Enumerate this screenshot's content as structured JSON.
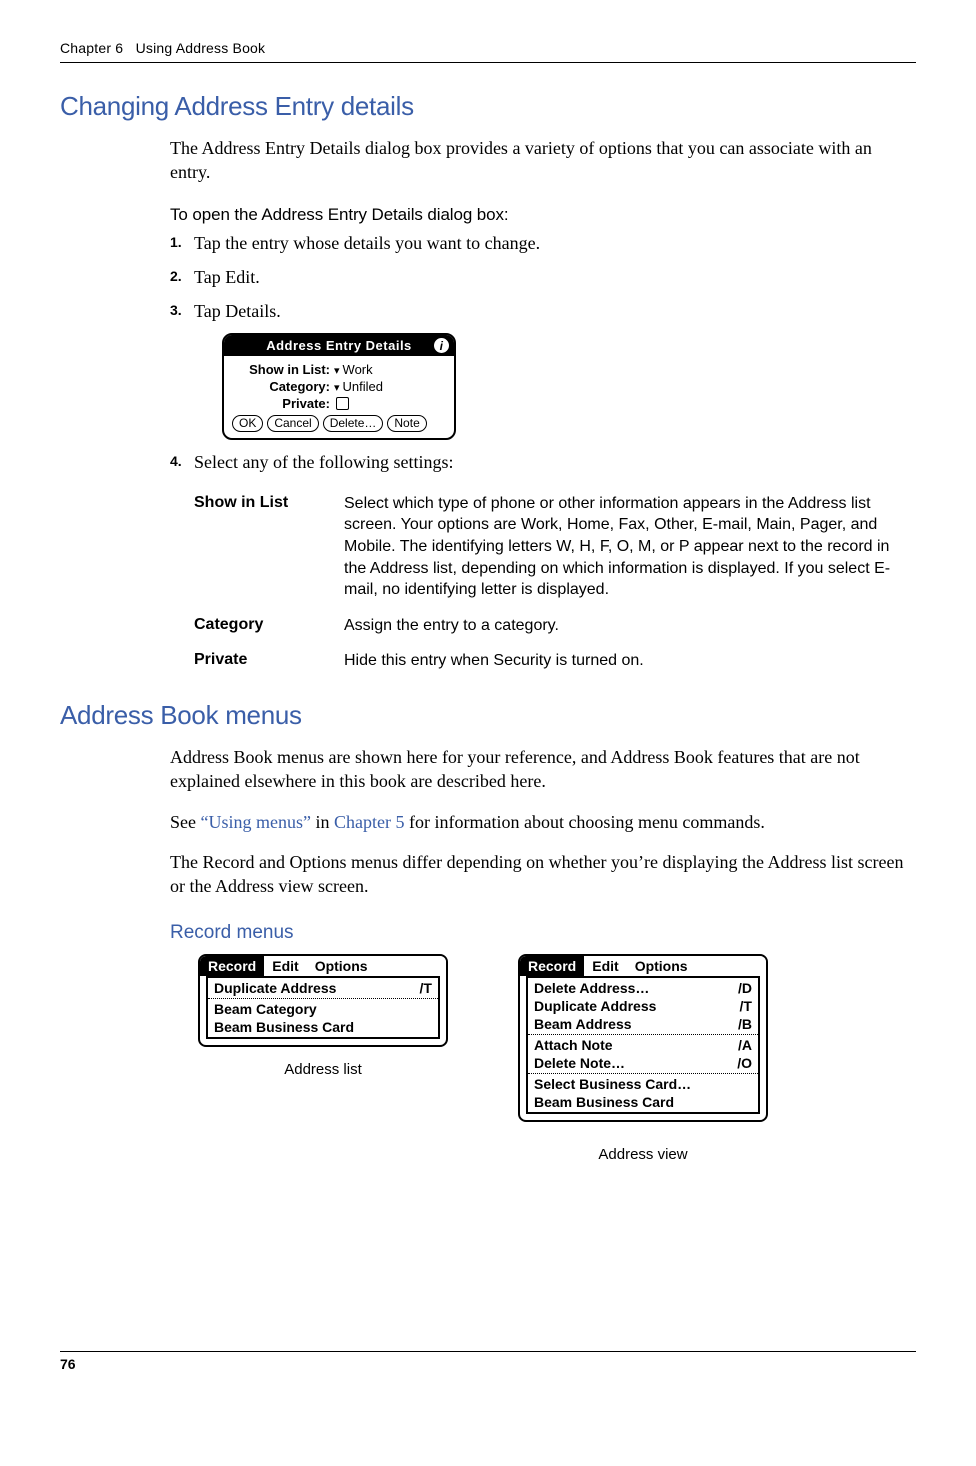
{
  "chapter_label": "Chapter 6",
  "chapter_title": "Using Address Book",
  "section1_title": "Changing Address Entry details",
  "section1_intro": "The Address Entry Details dialog box provides a variety of options that you can associate with an entry.",
  "howto_title": "To open the Address Entry Details dialog box:",
  "steps": {
    "1": "Tap the entry whose details you want to change.",
    "2": "Tap Edit.",
    "3": "Tap Details.",
    "4": "Select any of the following settings:"
  },
  "dialog": {
    "title": "Address Entry Details",
    "show_in_list_label": "Show in List:",
    "show_in_list_value": "Work",
    "category_label": "Category:",
    "category_value": "Unfiled",
    "private_label": "Private:",
    "buttons": {
      "ok": "OK",
      "cancel": "Cancel",
      "delete": "Delete…",
      "note": "Note"
    }
  },
  "settings": {
    "show_in_list_label": "Show in List",
    "show_in_list_desc": "Select which type of phone or other information appears in the Address list screen. Your options are Work, Home, Fax, Other, E-mail, Main, Pager, and Mobile. The identifying letters W, H, F, O, M, or P appear next to the record in the Address list, depending on which information is displayed. If you select E-mail, no identifying letter is displayed.",
    "category_label": "Category",
    "category_desc": "Assign the entry to a category.",
    "private_label": "Private",
    "private_desc": "Hide this entry when Security is turned on."
  },
  "section2_title": "Address Book menus",
  "section2_p1": "Address Book menus are shown here for your reference, and Address Book features that are not explained elsewhere in this book are described here.",
  "section2_p2a": "See ",
  "section2_link1": "“Using menus”",
  "section2_p2b": " in ",
  "section2_link2": "Chapter 5",
  "section2_p2c": " for information about choosing menu commands.",
  "section2_p3": "The Record and Options menus differ depending on whether you’re displaying the Address list screen or the Address view screen.",
  "record_menus_title": "Record menus",
  "menubar": {
    "record": "Record",
    "edit": "Edit",
    "options": "Options"
  },
  "list_menu": {
    "caption": "Address list",
    "items": [
      {
        "label": "Duplicate Address",
        "shortcut": "/T"
      },
      {
        "label": "Beam Category",
        "shortcut": ""
      },
      {
        "label": "Beam Business Card",
        "shortcut": ""
      }
    ]
  },
  "view_menu": {
    "caption": "Address view",
    "items": [
      {
        "label": "Delete Address…",
        "shortcut": "/D"
      },
      {
        "label": "Duplicate Address",
        "shortcut": "/T"
      },
      {
        "label": "Beam Address",
        "shortcut": "/B"
      },
      {
        "label": "Attach Note",
        "shortcut": "/A"
      },
      {
        "label": "Delete Note…",
        "shortcut": "/O"
      },
      {
        "label": "Select Business Card…",
        "shortcut": ""
      },
      {
        "label": "Beam Business Card",
        "shortcut": ""
      }
    ]
  },
  "page_number": "76"
}
